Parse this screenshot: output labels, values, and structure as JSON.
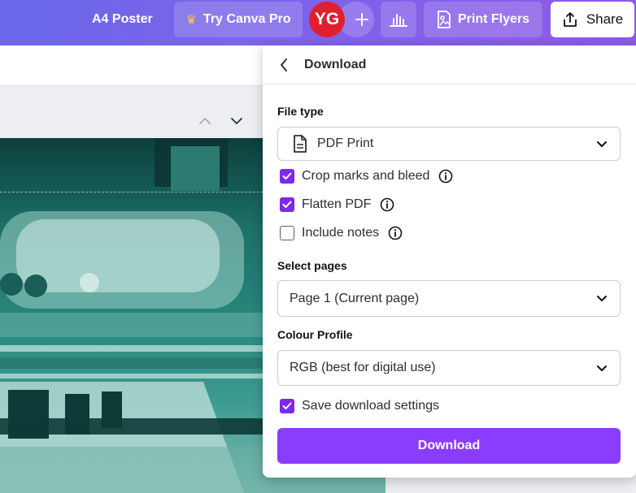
{
  "topbar": {
    "doc_title": "A4 Poster",
    "try_pro_label": "Try Canva Pro",
    "avatar_initials": "YG",
    "print_label": "Print Flyers",
    "share_label": "Share"
  },
  "colors": {
    "accent": "#8b3dff",
    "checkbox": "#7d2ae8",
    "avatar": "#e0202e"
  },
  "icons": [
    "crown-icon",
    "plus-icon",
    "chart-icon",
    "print-flyer-icon",
    "share-icon",
    "chevron-up-icon",
    "chevron-down-icon",
    "back-arrow-icon",
    "document-icon",
    "info-icon",
    "check-icon"
  ],
  "download_panel": {
    "title": "Download",
    "file_type_label": "File type",
    "file_type_value": "PDF Print",
    "options": [
      {
        "label": "Crop marks and bleed",
        "checked": true,
        "info": true
      },
      {
        "label": "Flatten PDF",
        "checked": true,
        "info": true
      },
      {
        "label": "Include notes",
        "checked": false,
        "info": true
      }
    ],
    "pages_label": "Select pages",
    "pages_value": "Page 1 (Current page)",
    "profile_label": "Colour Profile",
    "profile_value": "RGB (best for digital use)",
    "save_settings_label": "Save download settings",
    "save_settings_checked": true,
    "download_button": "Download"
  }
}
